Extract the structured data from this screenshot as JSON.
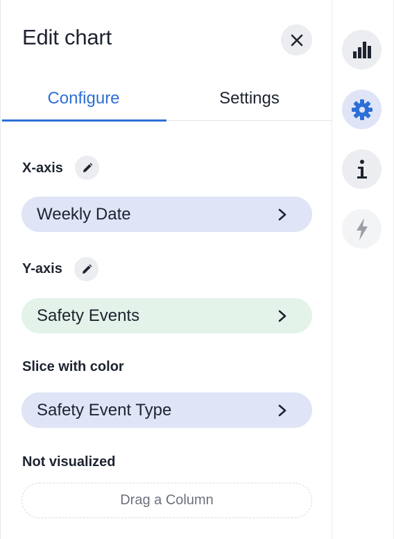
{
  "header": {
    "title": "Edit chart",
    "close_icon": "close-icon"
  },
  "tabs": [
    {
      "label": "Configure",
      "active": true
    },
    {
      "label": "Settings",
      "active": false
    }
  ],
  "sections": {
    "x_axis": {
      "label": "X-axis",
      "value": "Weekly Date",
      "color": "#dfe4f6"
    },
    "y_axis": {
      "label": "Y-axis",
      "value": "Safety Events",
      "color": "#e3f3ea"
    },
    "slice": {
      "label": "Slice with color",
      "value": "Safety Event Type",
      "color": "#dfe4f6"
    },
    "not_visualized": {
      "label": "Not visualized",
      "placeholder": "Drag a Column"
    }
  },
  "rail": [
    {
      "icon": "bar-chart-icon",
      "active": false
    },
    {
      "icon": "gear-icon",
      "active": true
    },
    {
      "icon": "info-icon",
      "active": false
    },
    {
      "icon": "lightning-icon",
      "active": false,
      "disabled": true
    }
  ],
  "colors": {
    "accent": "#2d6fd6",
    "text": "#1d232f",
    "muted": "#6b717c"
  }
}
